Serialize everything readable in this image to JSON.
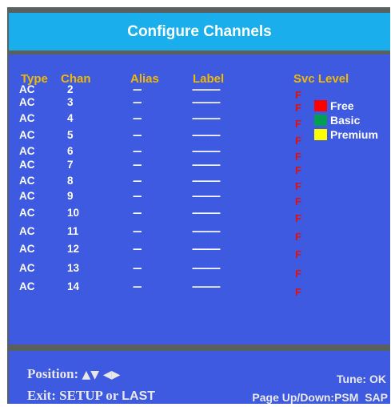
{
  "title": "Configure Channels",
  "headers": {
    "type": "Type",
    "chan": "Chan",
    "alias": "Alias",
    "label": "Label",
    "svc": "Svc Level"
  },
  "rows": [
    {
      "type": "AC",
      "chan": "2",
      "alias": "---",
      "label": "----------",
      "svc": "F"
    },
    {
      "type": "AC",
      "chan": "3",
      "alias": "---",
      "label": "----------",
      "svc": "F"
    },
    {
      "type": "AC",
      "chan": "4",
      "alias": "---",
      "label": "----------",
      "svc": "F"
    },
    {
      "type": "AC",
      "chan": "5",
      "alias": "---",
      "label": "----------",
      "svc": "F"
    },
    {
      "type": "AC",
      "chan": "6",
      "alias": "---",
      "label": "----------",
      "svc": "F"
    },
    {
      "type": "AC",
      "chan": "7",
      "alias": "---",
      "label": "----------",
      "svc": "F"
    },
    {
      "type": "AC",
      "chan": "8",
      "alias": "---",
      "label": "----------",
      "svc": "F"
    },
    {
      "type": "AC",
      "chan": "9",
      "alias": "---",
      "label": "----------",
      "svc": "F"
    },
    {
      "type": "AC",
      "chan": "10",
      "alias": "---",
      "label": "----------",
      "svc": "F"
    },
    {
      "type": "AC",
      "chan": "11",
      "alias": "---",
      "label": "----------",
      "svc": "F"
    },
    {
      "type": "AC",
      "chan": "12",
      "alias": "---",
      "label": "----------",
      "svc": "F"
    },
    {
      "type": "AC",
      "chan": "13",
      "alias": "---",
      "label": "----------",
      "svc": "F"
    },
    {
      "type": "AC",
      "chan": "14",
      "alias": "---",
      "label": "----------",
      "svc": "F"
    }
  ],
  "legend": [
    {
      "label": "Free",
      "color": "#ff0000"
    },
    {
      "label": "Basic",
      "color": "#00a050"
    },
    {
      "label": "Premium",
      "color": "#ffff00"
    }
  ],
  "footer": {
    "position_label": "Position:",
    "position_arrows": "▲▼ ◀▶",
    "exit_prefix": "Exit: SETUP or",
    "exit_last": "LAST",
    "tune": "Tune: OK",
    "page": "Page Up/Down:PSM  SAP"
  },
  "colors": {
    "title_bar": "#1aafec",
    "panel": "#3d5ae0",
    "header_text": "#f0b800",
    "svc_text": "#e01010",
    "frame": "#5a5f5f"
  }
}
